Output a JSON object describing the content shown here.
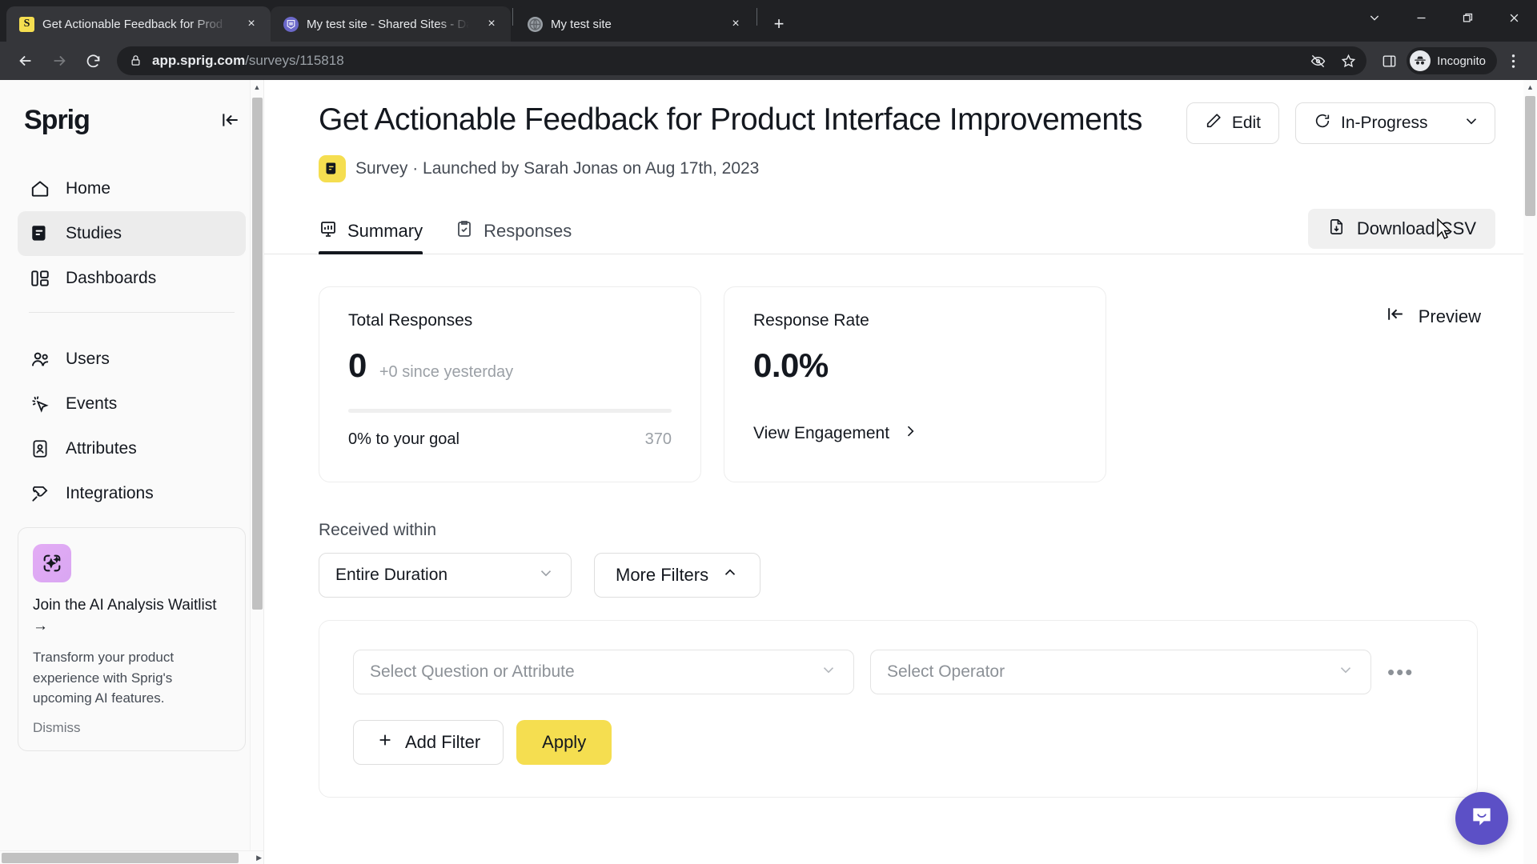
{
  "browser": {
    "tabs": [
      {
        "title": "Get Actionable Feedback for Prod",
        "favicon": "sprig-favicon",
        "active": true
      },
      {
        "title": "My test site - Shared Sites - Dash",
        "favicon": "wordpress-favicon",
        "active": false
      },
      {
        "title": "My test site",
        "favicon": "globe-favicon",
        "active": false
      }
    ],
    "new_tab_label": "+",
    "close_label": "×",
    "url_bold": "app.sprig.com",
    "url_dim": "/surveys/115818",
    "profile_label": "Incognito",
    "window_controls": {
      "minimize": "—",
      "maximize": "❐",
      "close": "✕",
      "tab_search": "⌄"
    }
  },
  "sidebar": {
    "logo": "Sprig",
    "collapse_icon": "collapse-panel-icon",
    "items": [
      {
        "label": "Home",
        "icon": "home-icon",
        "active": false
      },
      {
        "label": "Studies",
        "icon": "studies-icon",
        "active": true
      },
      {
        "label": "Dashboards",
        "icon": "dashboards-icon",
        "active": false
      },
      {
        "label": "Users",
        "icon": "users-icon",
        "active": false
      },
      {
        "label": "Events",
        "icon": "events-icon",
        "active": false
      },
      {
        "label": "Attributes",
        "icon": "attributes-icon",
        "active": false
      },
      {
        "label": "Integrations",
        "icon": "integrations-icon",
        "active": false
      }
    ],
    "promo": {
      "icon": "ai-sparkle-icon",
      "title": "Join the AI Analysis Waitlist →",
      "body": "Transform your product experience with Sprig's upcoming AI features.",
      "dismiss": "Dismiss"
    }
  },
  "header": {
    "title": "Get Actionable Feedback for Product Interface Improvements",
    "edit_label": "Edit",
    "status_label": "In-Progress",
    "subtitle": "Survey · Launched by Sarah Jonas on Aug 17th, 2023",
    "badge_icon": "survey-badge-icon"
  },
  "tabs": {
    "items": [
      {
        "label": "Summary",
        "icon": "chart-icon",
        "selected": true
      },
      {
        "label": "Responses",
        "icon": "clipboard-check-icon",
        "selected": false
      }
    ],
    "download_label": "Download CSV"
  },
  "cards": {
    "total_responses": {
      "label": "Total Responses",
      "value": "0",
      "delta": "+0 since yesterday",
      "goal_text": "0% to your goal",
      "goal_value": "370",
      "progress_percent": 0
    },
    "response_rate": {
      "label": "Response Rate",
      "value": "0.0%",
      "link_label": "View Engagement"
    },
    "preview_label": "Preview"
  },
  "filters": {
    "received_within_label": "Received within",
    "duration_value": "Entire Duration",
    "more_filters_label": "More Filters",
    "question_placeholder": "Select Question or Attribute",
    "operator_placeholder": "Select Operator",
    "overflow_label": "•••",
    "add_filter_label": "Add Filter",
    "apply_label": "Apply"
  },
  "chat": {
    "icon": "chat-bubble-icon"
  },
  "colors": {
    "brand_yellow": "#F5DE50",
    "text_dark": "#14181F",
    "muted": "#9BA0A6",
    "chat_purple": "#5C50C6"
  }
}
